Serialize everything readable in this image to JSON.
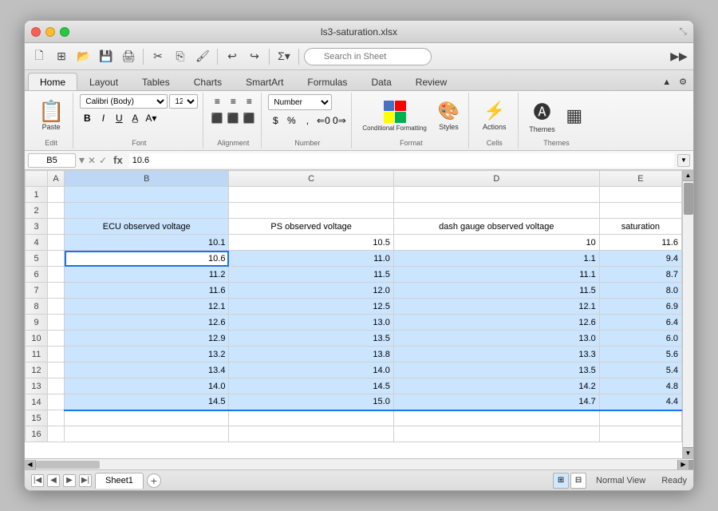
{
  "window": {
    "title": "ls3-saturation.xlsx"
  },
  "toolbar": {
    "search_placeholder": "Search in Sheet"
  },
  "ribbon": {
    "tabs": [
      {
        "id": "home",
        "label": "Home",
        "active": true
      },
      {
        "id": "layout",
        "label": "Layout"
      },
      {
        "id": "tables",
        "label": "Tables"
      },
      {
        "id": "charts",
        "label": "Charts"
      },
      {
        "id": "smartart",
        "label": "SmartArt"
      },
      {
        "id": "formulas",
        "label": "Formulas"
      },
      {
        "id": "data",
        "label": "Data"
      },
      {
        "id": "review",
        "label": "Review"
      }
    ],
    "groups": {
      "edit": "Edit",
      "font": "Font",
      "alignment": "Alignment",
      "number": "Number",
      "format": "Format",
      "cells": "Cells",
      "actions": "Actions",
      "themes": "Themes"
    },
    "font_name": "Calibri (Body)",
    "font_size": "12",
    "number_format": "Number"
  },
  "formula_bar": {
    "cell_ref": "B5",
    "formula": "10.6"
  },
  "columns": [
    "",
    "A",
    "B",
    "C",
    "D",
    "E"
  ],
  "column_headers": {
    "B": "ECU observed voltage",
    "C": "PS observed voltage",
    "D": "dash gauge observed voltage",
    "E": "saturation"
  },
  "rows": [
    {
      "row": 1,
      "A": "",
      "B": "",
      "C": "",
      "D": "",
      "E": ""
    },
    {
      "row": 2,
      "A": "",
      "B": "",
      "C": "",
      "D": "",
      "E": ""
    },
    {
      "row": 3,
      "A": "",
      "B": "ECU observed voltage",
      "C": "PS observed voltage",
      "D": "dash gauge observed voltage",
      "E": "saturation"
    },
    {
      "row": 4,
      "A": "",
      "B": "10.1",
      "C": "10.5",
      "D": "10",
      "E": "11.6"
    },
    {
      "row": 5,
      "A": "",
      "B": "10.6",
      "C": "11.0",
      "D": "1.1",
      "E": "9.4"
    },
    {
      "row": 6,
      "A": "",
      "B": "11.2",
      "C": "11.5",
      "D": "11.1",
      "E": "8.7"
    },
    {
      "row": 7,
      "A": "",
      "B": "11.6",
      "C": "12.0",
      "D": "11.5",
      "E": "8.0"
    },
    {
      "row": 8,
      "A": "",
      "B": "12.1",
      "C": "12.5",
      "D": "12.1",
      "E": "6.9"
    },
    {
      "row": 9,
      "A": "",
      "B": "12.6",
      "C": "13.0",
      "D": "12.6",
      "E": "6.4"
    },
    {
      "row": 10,
      "A": "",
      "B": "12.9",
      "C": "13.5",
      "D": "13.0",
      "E": "6.0"
    },
    {
      "row": 11,
      "A": "",
      "B": "13.2",
      "C": "13.8",
      "D": "13.3",
      "E": "5.6"
    },
    {
      "row": 12,
      "A": "",
      "B": "13.4",
      "C": "14.0",
      "D": "13.5",
      "E": "5.4"
    },
    {
      "row": 13,
      "A": "",
      "B": "14.0",
      "C": "14.5",
      "D": "14.2",
      "E": "4.8"
    },
    {
      "row": 14,
      "A": "",
      "B": "14.5",
      "C": "15.0",
      "D": "14.7",
      "E": "4.4"
    },
    {
      "row": 15,
      "A": "",
      "B": "",
      "C": "",
      "D": "",
      "E": ""
    },
    {
      "row": 16,
      "A": "",
      "B": "",
      "C": "",
      "D": "",
      "E": ""
    }
  ],
  "status": {
    "view": "Normal View",
    "ready": "Ready",
    "sheet": "Sheet1"
  },
  "buttons": {
    "paste": "Paste",
    "bold": "B",
    "italic": "I",
    "underline": "U",
    "align": "Align",
    "conditional_formatting": "Conditional Formatting",
    "styles": "Styles",
    "actions": "Actions",
    "themes": "Themes",
    "add_sheet": "+"
  },
  "colors": {
    "selected_bg": "#cce5ff",
    "header_bg": "#bdd7f5",
    "active_outline": "#1a73e8",
    "tab_active_bg": "#f0f0f0"
  }
}
